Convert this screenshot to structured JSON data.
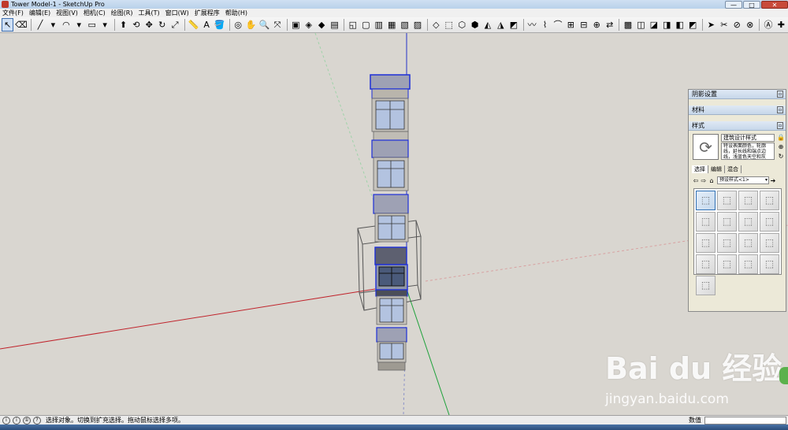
{
  "window": {
    "title": "Tower Model-1 - SketchUp Pro",
    "controls": [
      "—",
      "□",
      "✕"
    ]
  },
  "menubar": {
    "items": [
      "文件(F)",
      "编辑(E)",
      "视图(V)",
      "相机(C)",
      "绘图(R)",
      "工具(T)",
      "窗口(W)",
      "扩展程序",
      "帮助(H)"
    ]
  },
  "toolbar": {
    "tools": [
      {
        "name": "select",
        "glyph": "↖"
      },
      {
        "name": "eraser",
        "glyph": "⌫"
      },
      {
        "name": "line",
        "glyph": "╱"
      },
      {
        "name": "line-dropdown",
        "glyph": "▾"
      },
      {
        "name": "arc",
        "glyph": "◠"
      },
      {
        "name": "arc-dropdown",
        "glyph": "▾"
      },
      {
        "name": "rectangle",
        "glyph": "▭"
      },
      {
        "name": "rectangle-dropdown",
        "glyph": "▾"
      },
      {
        "name": "push-pull",
        "glyph": "⬆"
      },
      {
        "name": "offset",
        "glyph": "⟲"
      },
      {
        "name": "move",
        "glyph": "✥"
      },
      {
        "name": "rotate",
        "glyph": "↻"
      },
      {
        "name": "scale",
        "glyph": "⤢"
      },
      {
        "name": "tape-measure",
        "glyph": "📏"
      },
      {
        "name": "text",
        "glyph": "A"
      },
      {
        "name": "paint-bucket",
        "glyph": "🪣"
      },
      {
        "name": "orbit",
        "glyph": "◎"
      },
      {
        "name": "pan",
        "glyph": "✋"
      },
      {
        "name": "zoom",
        "glyph": "🔍"
      },
      {
        "name": "zoom-extents",
        "glyph": "⤧"
      },
      {
        "name": "warehouse",
        "glyph": "▣"
      },
      {
        "name": "extension-warehouse",
        "glyph": "◈"
      },
      {
        "name": "ruby",
        "glyph": "◆"
      },
      {
        "name": "layout",
        "glyph": "▤"
      },
      {
        "name": "view-iso",
        "glyph": "◱"
      },
      {
        "name": "view-top",
        "glyph": "▢"
      },
      {
        "name": "view-front",
        "glyph": "▥"
      },
      {
        "name": "view-right",
        "glyph": "▦"
      },
      {
        "name": "view-back",
        "glyph": "▧"
      },
      {
        "name": "view-left",
        "glyph": "▨"
      },
      {
        "name": "xray",
        "glyph": "◇"
      },
      {
        "name": "back-edges",
        "glyph": "⬚"
      },
      {
        "name": "wireframe",
        "glyph": "⬡"
      },
      {
        "name": "hidden-line",
        "glyph": "⬢"
      },
      {
        "name": "shaded",
        "glyph": "◭"
      },
      {
        "name": "shaded-textures",
        "glyph": "◮"
      },
      {
        "name": "monochrome",
        "glyph": "◩"
      },
      {
        "name": "sandbox-contours",
        "glyph": "〰"
      },
      {
        "name": "sandbox-scratch",
        "glyph": "⌇"
      },
      {
        "name": "smoove",
        "glyph": "⌒"
      },
      {
        "name": "stamp",
        "glyph": "⊞"
      },
      {
        "name": "drape",
        "glyph": "⊟"
      },
      {
        "name": "add-detail",
        "glyph": "⊕"
      },
      {
        "name": "flip-edge",
        "glyph": "⇄"
      },
      {
        "name": "solid-outer-shell",
        "glyph": "▩"
      },
      {
        "name": "solid-intersect",
        "glyph": "◫"
      },
      {
        "name": "solid-union",
        "glyph": "◪"
      },
      {
        "name": "solid-subtract",
        "glyph": "◨"
      },
      {
        "name": "solid-trim",
        "glyph": "◧"
      },
      {
        "name": "solid-split",
        "glyph": "◩"
      },
      {
        "name": "follow-me",
        "glyph": "➤"
      },
      {
        "name": "section-plane",
        "glyph": "✂"
      },
      {
        "name": "display-section",
        "glyph": "⊘"
      },
      {
        "name": "section-cuts",
        "glyph": "⊗"
      },
      {
        "name": "3d-text",
        "glyph": "Ⓐ"
      },
      {
        "name": "axes",
        "glyph": "✚"
      }
    ]
  },
  "tray": {
    "panels": [
      {
        "title": "阴影设置"
      },
      {
        "title": "材料"
      },
      {
        "title": "样式"
      }
    ],
    "style": {
      "name": "建筑设计样式",
      "description": "特设表面颜色，轮廓线，延长线和端点边线，浅蓝色天空和灰"
    },
    "tabs": [
      "选择",
      "编辑",
      "混合"
    ],
    "collection": "预设样式<1>",
    "thumbnail_count": 17,
    "selected_thumbnail": 0
  },
  "statusbar": {
    "message": "选择对象。切换到扩充选择。拖动鼠标选择多项。",
    "measurements_label": "数值",
    "icons": [
      "i",
      "i",
      "①",
      "?"
    ]
  },
  "watermark": {
    "brand": "Bai du 经验",
    "domain": "jingyan.baidu.com"
  },
  "colors": {
    "viewport_background": "#d9d6d0",
    "axis_red": "#c0232b",
    "axis_green": "#1fa23b",
    "axis_blue": "#2433c8",
    "selection_blue": "#1d2fd8"
  }
}
